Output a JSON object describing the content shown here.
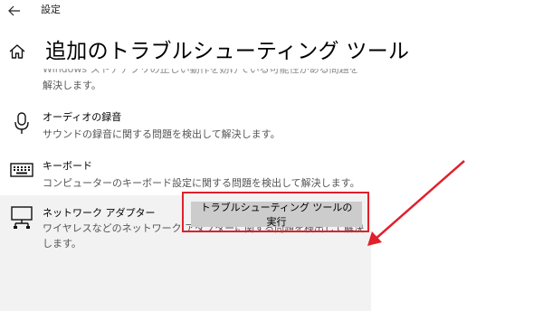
{
  "window": {
    "title": "設定"
  },
  "page": {
    "title": "追加のトラブルシューティング ツール"
  },
  "items": {
    "partial": {
      "line1": "Windows ストアアプリの正しい動作を妨げている可能性がある問題を",
      "line2": "解決します。"
    },
    "audio_recording": {
      "name": "オーディオの録音",
      "description": "サウンドの録音に関する問題を検出して解決します。"
    },
    "keyboard": {
      "name": "キーボード",
      "description": "コンピューターのキーボード設定に関する問題を検出して解決します。"
    },
    "network_adapter": {
      "name": "ネットワーク アダプター",
      "description": "ワイヤレスなどのネットワーク アダプターに関する問題を検出して解決します。"
    }
  },
  "run_button": {
    "label": "トラブルシューティング ツールの実行"
  },
  "annotation": {
    "color": "#e0202a"
  },
  "icons": [
    "back-arrow-icon",
    "home-icon",
    "microphone-icon",
    "keyboard-icon",
    "network-adapter-icon"
  ]
}
